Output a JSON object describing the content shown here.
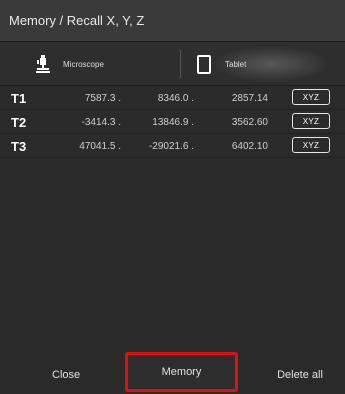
{
  "window": {
    "title": "Memory / Recall X, Y, Z"
  },
  "modes": {
    "microscope": {
      "label": "Microscope",
      "icon": "microscope-icon"
    },
    "tablet": {
      "label": "Tablet",
      "icon": "tablet-icon",
      "selected": true
    }
  },
  "memory_rows": [
    {
      "id": "T1",
      "x": "7587.3 .",
      "y": "8346.0 .",
      "z": "2857.14",
      "button": "XYZ"
    },
    {
      "id": "T2",
      "x": "-3414.3 .",
      "y": "13846.9 .",
      "z": "3562.60",
      "button": "XYZ"
    },
    {
      "id": "T3",
      "x": "47041.5 .",
      "y": "-29021.6 .",
      "z": "6402.10",
      "button": "XYZ"
    }
  ],
  "footer": {
    "close_label": "Close",
    "memory_label": "Memory",
    "delete_all_label": "Delete all"
  },
  "colors": {
    "background": "#2b2b2b",
    "highlight": "#e01010",
    "text": "#ffffff"
  }
}
